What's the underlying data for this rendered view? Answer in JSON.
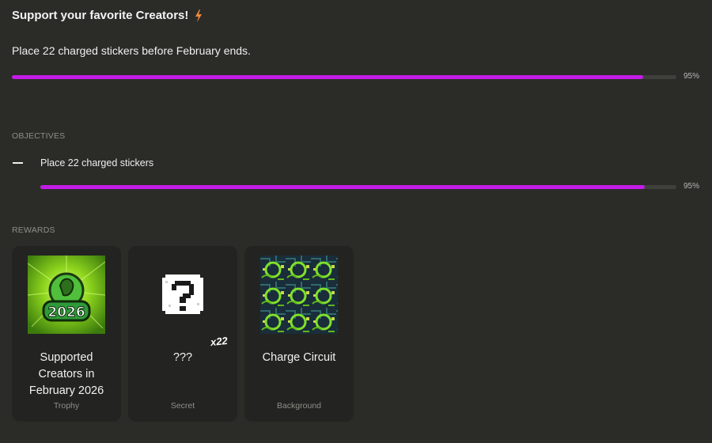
{
  "header": {
    "title": "Support your favorite Creators!",
    "icon": "lightning-bolt-icon",
    "accent_color": "#f08a3c"
  },
  "quest": {
    "description": "Place 22 charged stickers before February ends.",
    "progress_percent": 95,
    "progress_label": "95%",
    "progress_color": "#c21ce6"
  },
  "objectives": {
    "heading": "OBJECTIVES",
    "items": [
      {
        "label": "Place 22 charged stickers",
        "progress_percent": 95,
        "progress_label": "95%"
      }
    ]
  },
  "rewards": {
    "heading": "REWARDS",
    "items": [
      {
        "name": "Supported Creators in February 2026",
        "type": "Trophy",
        "image": "2026-trophy-icon"
      },
      {
        "name": "???",
        "type": "Secret",
        "image": "mystery-question-icon",
        "quantity": "x22"
      },
      {
        "name": "Charge Circuit",
        "type": "Background",
        "image": "circuit-pattern-icon"
      }
    ]
  }
}
